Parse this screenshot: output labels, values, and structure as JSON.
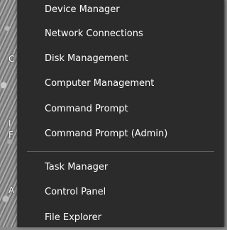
{
  "desktop": {
    "peek_glyphs": [
      "C",
      "I",
      "F",
      "A"
    ]
  },
  "menu": {
    "items_top": [
      {
        "label": "Device Manager"
      },
      {
        "label": "Network Connections"
      },
      {
        "label": "Disk Management"
      },
      {
        "label": "Computer Management"
      },
      {
        "label": "Command Prompt"
      },
      {
        "label": "Command Prompt (Admin)"
      }
    ],
    "items_bottom": [
      {
        "label": "Task Manager"
      },
      {
        "label": "Control Panel"
      },
      {
        "label": "File Explorer"
      }
    ]
  }
}
